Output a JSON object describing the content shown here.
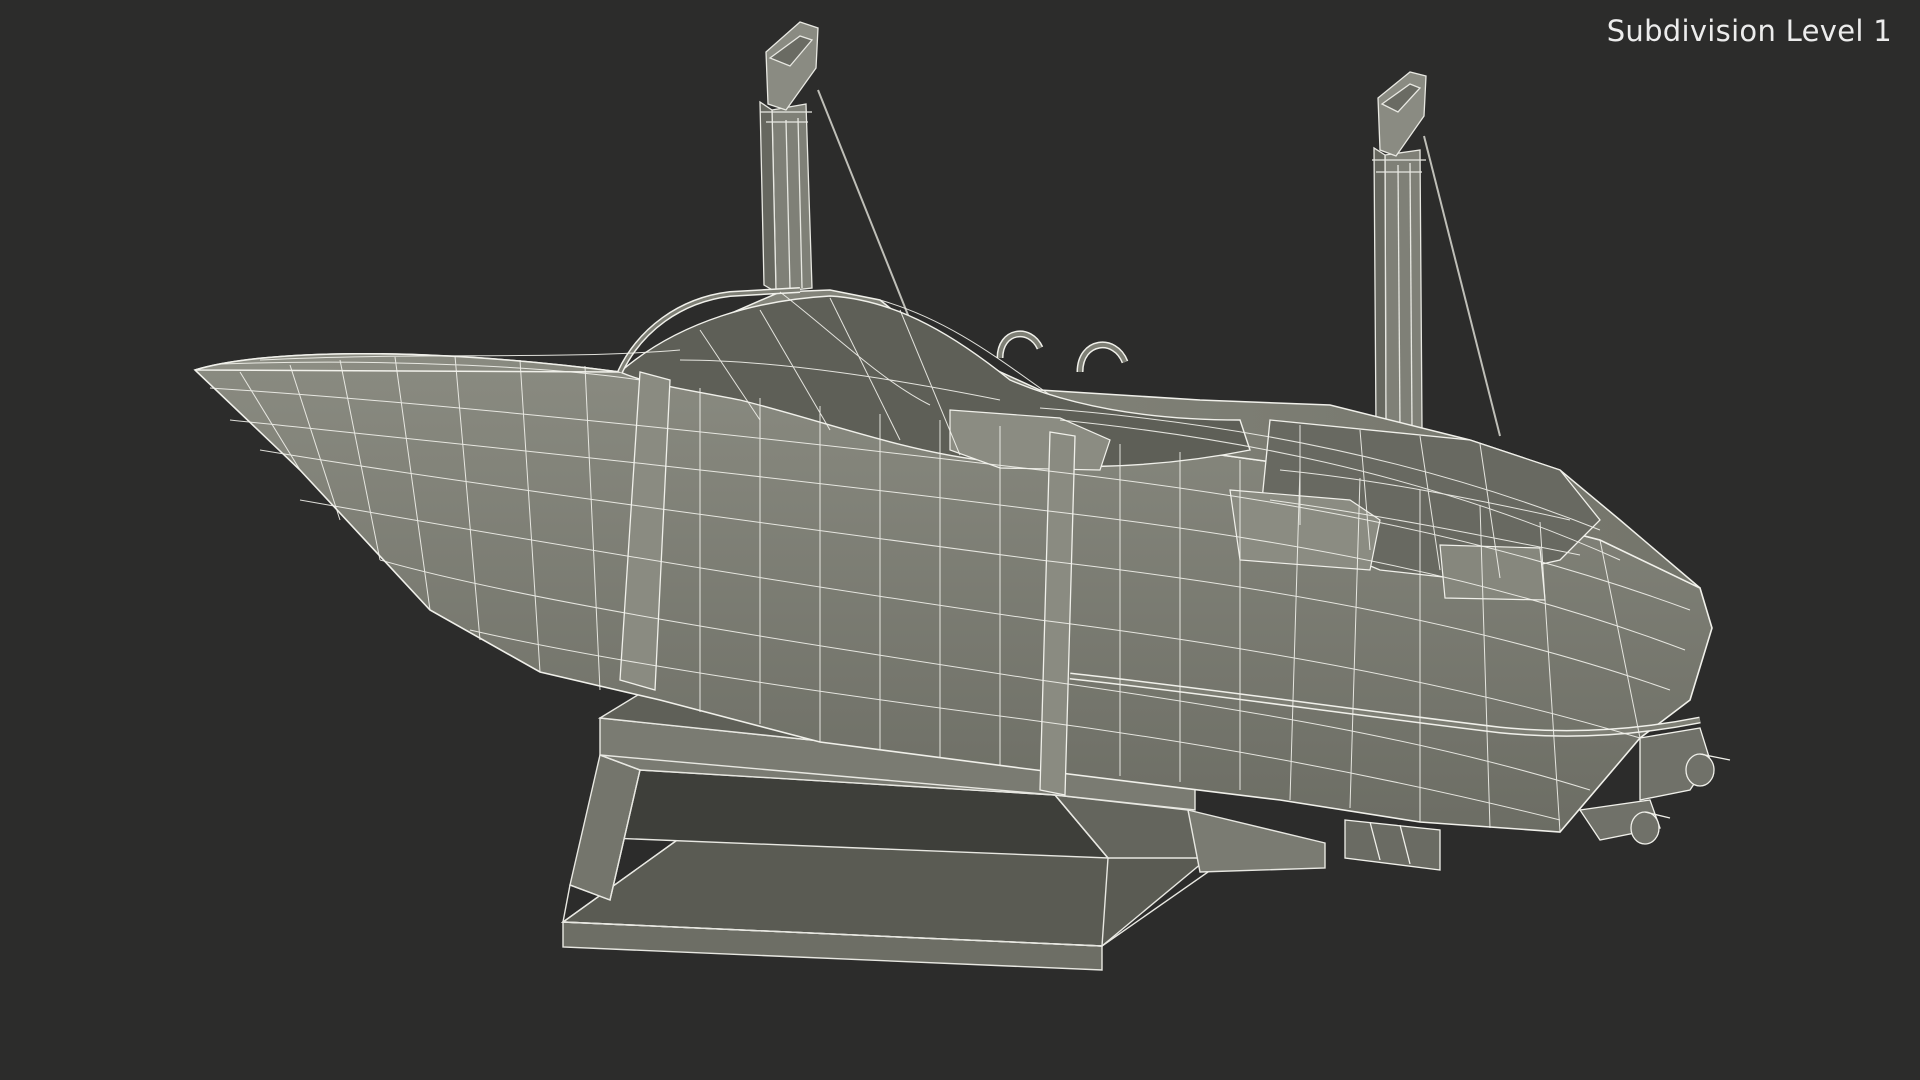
{
  "viewport": {
    "overlay_label": "Subdivision Level 1",
    "background_color": "#2c2c2b",
    "mesh_face_color": "#7e7f75",
    "mesh_dark_color": "#595a52",
    "wire_color": "#f2f2ec"
  }
}
